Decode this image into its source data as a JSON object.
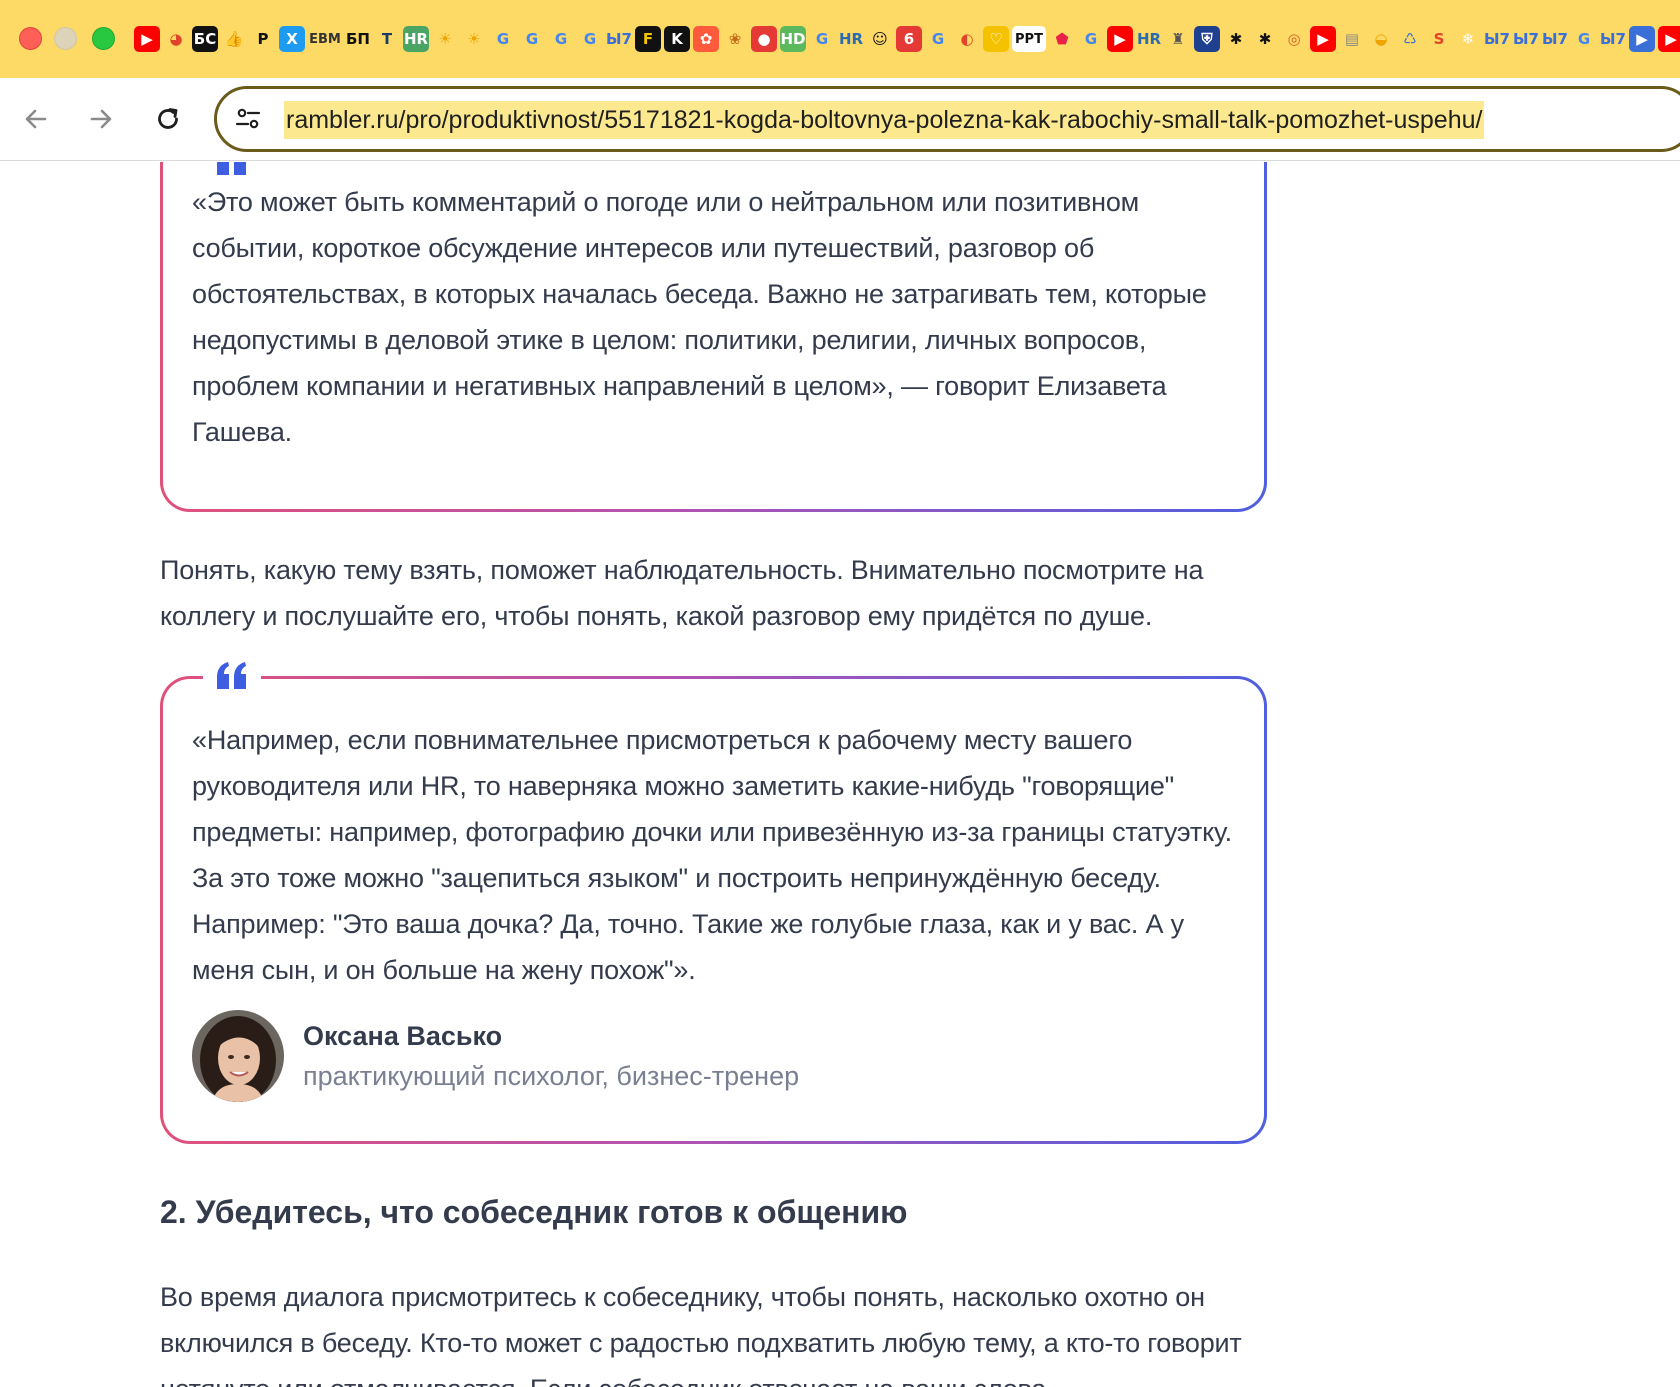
{
  "browser": {
    "window_controls": [
      "close",
      "minimize",
      "zoom"
    ],
    "bookmarks": [
      {
        "icon": "youtube-icon",
        "text": "▶",
        "bg": "#ff0000",
        "fg": "#ffffff"
      },
      {
        "icon": "pie-chart-icon",
        "text": "◕",
        "bg": "#fdd965",
        "fg": "#e0442a"
      },
      {
        "icon": "bk-icon",
        "text": "БС",
        "bg": "#111111",
        "fg": "#ffffff"
      },
      {
        "icon": "thumbs-up-icon",
        "text": "👍",
        "bg": "#fdd965",
        "fg": "#1a73e8"
      },
      {
        "icon": "p-icon",
        "text": "Р",
        "bg": "#fdd965",
        "fg": "#111111"
      },
      {
        "icon": "x-icon",
        "text": "X",
        "bg": "#1d9bf0",
        "fg": "#ffffff"
      },
      {
        "icon": "ebm-icon",
        "text": "EBM",
        "bg": "#fdd965",
        "fg": "#333333"
      },
      {
        "icon": "bp-icon",
        "text": "БП",
        "bg": "#fdd965",
        "fg": "#111111"
      },
      {
        "icon": "t-icon",
        "text": "T",
        "bg": "#fdd965",
        "fg": "#1b3a66"
      },
      {
        "icon": "hr-icon",
        "text": "HR",
        "bg": "#4aa564",
        "fg": "#ffffff"
      },
      {
        "icon": "sun-icon",
        "text": "☀",
        "bg": "#fdd965",
        "fg": "#f0a400"
      },
      {
        "icon": "sun-icon",
        "text": "☀",
        "bg": "#fdd965",
        "fg": "#f0a400"
      },
      {
        "icon": "google-icon",
        "text": "G",
        "bg": "#fdd965",
        "fg": "#4285f4"
      },
      {
        "icon": "google-icon",
        "text": "G",
        "bg": "#fdd965",
        "fg": "#4285f4"
      },
      {
        "icon": "google-icon",
        "text": "G",
        "bg": "#fdd965",
        "fg": "#4285f4"
      },
      {
        "icon": "google-icon",
        "text": "G",
        "bg": "#fdd965",
        "fg": "#4285f4"
      },
      {
        "icon": "by-icon",
        "text": "Ы7",
        "bg": "#fdd965",
        "fg": "#3a6fd8"
      },
      {
        "icon": "f-icon",
        "text": "F",
        "bg": "#111111",
        "fg": "#f5c200"
      },
      {
        "icon": "k-icon",
        "text": "K",
        "bg": "#111111",
        "fg": "#ffffff"
      },
      {
        "icon": "flower-icon",
        "text": "✿",
        "bg": "#ff5a3c",
        "fg": "#ffffff"
      },
      {
        "icon": "basket-icon",
        "text": "❀",
        "bg": "#fdd965",
        "fg": "#c46a1a"
      },
      {
        "icon": "record-icon",
        "text": "●",
        "bg": "#e53935",
        "fg": "#ffffff"
      },
      {
        "icon": "hd-icon",
        "text": "HD",
        "bg": "#5cb85c",
        "fg": "#ffffff"
      },
      {
        "icon": "google-icon",
        "text": "G",
        "bg": "#fdd965",
        "fg": "#4285f4"
      },
      {
        "icon": "hr-icon",
        "text": "HR",
        "bg": "#fdd965",
        "fg": "#2b6cb0"
      },
      {
        "icon": "smile-icon",
        "text": "☺",
        "bg": "#fdd965",
        "fg": "#111111"
      },
      {
        "icon": "six-icon",
        "text": "6",
        "bg": "#e53935",
        "fg": "#ffffff"
      },
      {
        "icon": "google-icon",
        "text": "G",
        "bg": "#fdd965",
        "fg": "#4285f4"
      },
      {
        "icon": "moon-icon",
        "text": "◐",
        "bg": "#fdd965",
        "fg": "#e0442a"
      },
      {
        "icon": "heart-icon",
        "text": "♡",
        "bg": "#f5c200",
        "fg": "#ffffff"
      },
      {
        "icon": "ppt-icon",
        "text": "PPT",
        "bg": "#ffffff",
        "fg": "#111111"
      },
      {
        "icon": "pentagon-icon",
        "text": "⬟",
        "bg": "#fdd965",
        "fg": "#e8204a"
      },
      {
        "icon": "google-icon",
        "text": "G",
        "bg": "#fdd965",
        "fg": "#4285f4"
      },
      {
        "icon": "youtube-icon",
        "text": "▶",
        "bg": "#ff0000",
        "fg": "#ffffff"
      },
      {
        "icon": "hr-icon",
        "text": "HR",
        "bg": "#fdd965",
        "fg": "#2b6cb0"
      },
      {
        "icon": "hat-icon",
        "text": "♜",
        "bg": "#fdd965",
        "fg": "#555555"
      },
      {
        "icon": "shield-icon",
        "text": "⛨",
        "bg": "#1f3f8f",
        "fg": "#ffffff"
      },
      {
        "icon": "paw-icon",
        "text": "✱",
        "bg": "#fdd965",
        "fg": "#111111"
      },
      {
        "icon": "paw-icon",
        "text": "✱",
        "bg": "#fdd965",
        "fg": "#111111"
      },
      {
        "icon": "fingerprint-icon",
        "text": "◎",
        "bg": "#fdd965",
        "fg": "#d95c2b"
      },
      {
        "icon": "youtube-icon",
        "text": "▶",
        "bg": "#ff0000",
        "fg": "#ffffff"
      },
      {
        "icon": "chart-icon",
        "text": "▤",
        "bg": "#fdd965",
        "fg": "#888888"
      },
      {
        "icon": "duck-icon",
        "text": "◒",
        "bg": "#fdd965",
        "fg": "#f0a400"
      },
      {
        "icon": "swirl-icon",
        "text": "♺",
        "bg": "#fdd965",
        "fg": "#3a6fd8"
      },
      {
        "icon": "s-icon",
        "text": "S",
        "bg": "#fdd965",
        "fg": "#e0442a"
      },
      {
        "icon": "snowflake-icon",
        "text": "❄",
        "bg": "#fdd965",
        "fg": "#ffffff"
      },
      {
        "icon": "by-icon",
        "text": "Ы7",
        "bg": "#fdd965",
        "fg": "#3a6fd8"
      },
      {
        "icon": "by-icon",
        "text": "Ы7",
        "bg": "#fdd965",
        "fg": "#3a6fd8"
      },
      {
        "icon": "by-icon",
        "text": "Ы7",
        "bg": "#fdd965",
        "fg": "#3a6fd8"
      },
      {
        "icon": "google-icon",
        "text": "G",
        "bg": "#fdd965",
        "fg": "#4285f4"
      },
      {
        "icon": "by-icon",
        "text": "Ы7",
        "bg": "#fdd965",
        "fg": "#3a6fd8"
      },
      {
        "icon": "play-icon",
        "text": "▶",
        "bg": "#3a6fd8",
        "fg": "#ffffff"
      },
      {
        "icon": "youtube-icon",
        "text": "▶",
        "bg": "#ff0000",
        "fg": "#ffffff"
      },
      {
        "icon": "play-icon",
        "text": "▶",
        "bg": "#3a6fd8",
        "fg": "#ffffff"
      }
    ],
    "address_bar": {
      "url": "rambler.ru/pro/produktivnost/55171821-kogda-boltovnya-polezna-kak-rabochiy-small-talk-pomozhet-uspehu/"
    }
  },
  "article": {
    "quote1": {
      "text": "«Это может быть комментарий о погоде или о нейтральном или позитивном событии, короткое обсуждение интересов или путешествий, разговор об обстоятельствах, в которых началась беседа. Важно не затрагивать тем, которые недопустимы в деловой этике в целом: политики, религии, личных вопросов, проблем компании и негативных направлений в целом», — говорит Елизавета Гашева."
    },
    "paragraph1": "Понять, какую тему взять, поможет наблюдательность. Внимательно посмотрите на коллегу и послушайте его, чтобы понять, какой разговор ему придётся по душе.",
    "quote2": {
      "text": "«Например, если повнимательнее присмотреться к рабочему месту вашего руководителя или HR, то наверняка можно заметить какие-нибудь \"говорящие\" предметы: например, фотографию дочки или привезённую из-за границы статуэтку. За это тоже можно \"зацепиться языком\" и построить непринуждённую беседу. Например: \"Это ваша дочка? Да, точно. Такие же голубые глаза, как и у вас. А у меня сын, и он больше на жену похож\"».",
      "author_name": "Оксана Васько",
      "author_role": "практикующий психолог, бизнес-тренер"
    },
    "heading2": "2. Убедитесь, что собеседник готов к общению",
    "paragraph2": "Во время диалога присмотритесь к собеседнику, чтобы понять, насколько охотно он включился в беседу. Кто-то может с радостью подхватить любую тему, а кто-то говорит нетянуто или отмалчивается. Если собеседник отвечает на ваши слова"
  },
  "colors": {
    "tabstrip": "#fdd965",
    "quote_mark": "#3d5ee0",
    "text": "#343b4c",
    "muted": "#7a8091",
    "gradient_start": "#e0517a",
    "gradient_end": "#4f5fe0"
  }
}
